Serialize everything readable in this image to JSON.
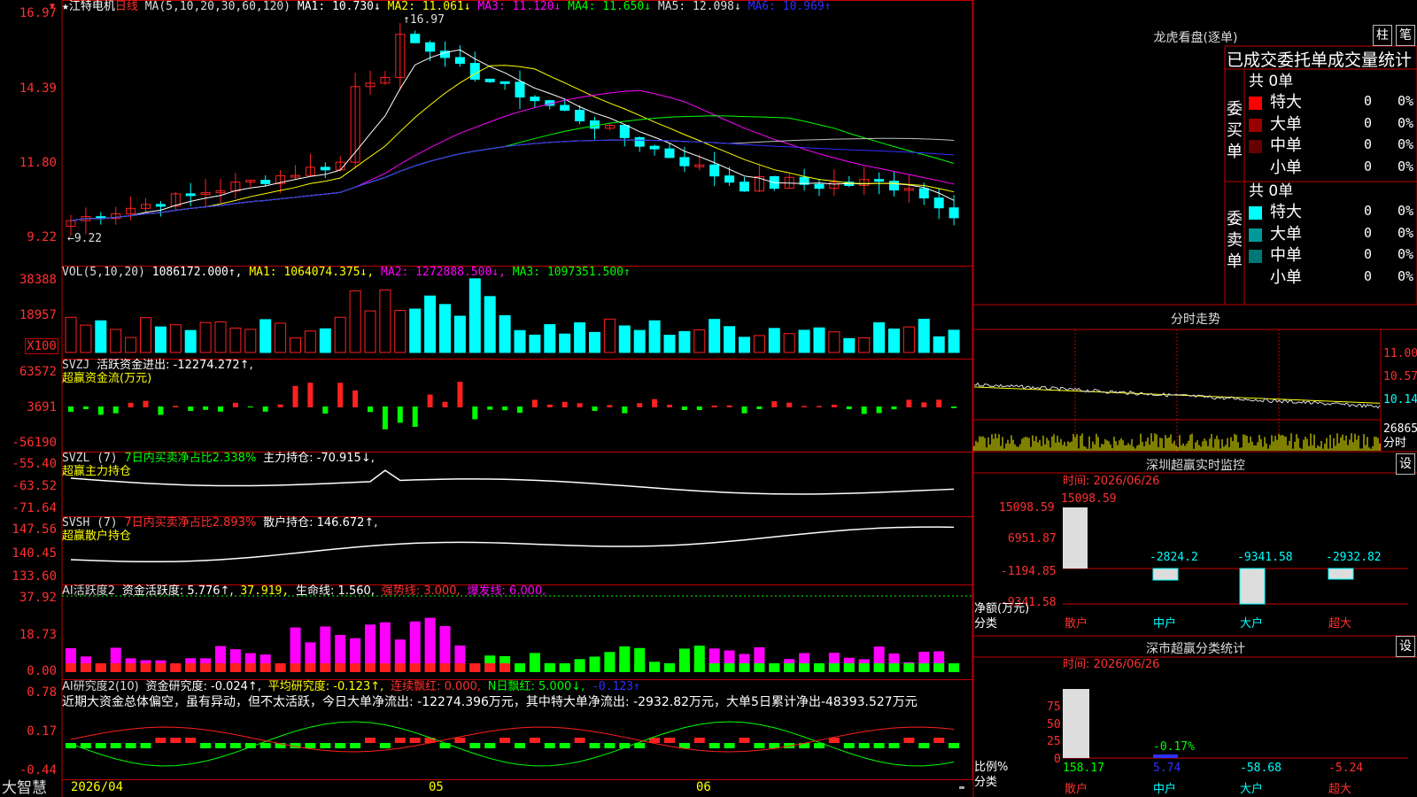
{
  "stock": {
    "star": "★",
    "name": "江特电机",
    "period": "日线",
    "period_marker": "▼"
  },
  "ma_line": {
    "label": "MA(5,10,20,30,60,120)",
    "ma1": "MA1: 10.730↓",
    "ma2": "MA2: 11.061↓",
    "ma3": "MA3: 11.120↓",
    "ma4": "MA4: 11.650↓",
    "ma5": "MA5: 12.098↓",
    "ma6": "MA6: 10.969↑"
  },
  "price_axis": [
    "16.97",
    "14.39",
    "11.80",
    "9.22"
  ],
  "price_notes": {
    "high": "16.97",
    "low": "9.22"
  },
  "vol": {
    "label": "VOL(5,10,20)",
    "value": "1086172.000↑,",
    "ma1": "MA1: 1064074.375↓,",
    "ma2": "MA2: 1272888.500↓,",
    "ma3": "MA3: 1097351.500↑",
    "axis": [
      "38388",
      "18957"
    ],
    "unit": "X100"
  },
  "svzj": {
    "label": "SVZJ",
    "text": "活跃资金进出: -12274.272↑,",
    "sub": "超赢资金流(万元)",
    "axis": [
      "63572",
      "3691",
      "-56190"
    ]
  },
  "svzl": {
    "label": "SVZL (7)",
    "pct": "7日内买卖净占比2.338%",
    "hold": "主力持仓: -70.915↓,",
    "sub": "超赢主力持仓",
    "axis": [
      "-55.40",
      "-63.52",
      "-71.64"
    ]
  },
  "svsh": {
    "label": "SVSH (7)",
    "pct": "7日内买卖净占比2.893%",
    "hold": "散户持仓: 146.672↑,",
    "sub": "超赢散户持仓",
    "axis": [
      "147.56",
      "140.45",
      "133.60"
    ]
  },
  "ai1": {
    "label": "AI活跃度2",
    "act": "资金活跃度: 5.776↑,",
    "v2": "37.919,",
    "life": "生命线: 1.560,",
    "strong": "强势线: 3.000,",
    "burst": "爆发线: 6.000,",
    "axis": [
      "37.92",
      "18.73",
      "0.00"
    ]
  },
  "ai2": {
    "label": "AI研究度2(10)",
    "res": "资金研究度: -0.024↑,",
    "avg": "平均研究度: -0.123↑,",
    "red": "连续飘红: 0.000,",
    "nred": "N日飘红: 5.000↓,",
    "last": "-0.123↑",
    "axis": [
      "0.78",
      "0.17",
      "-0.44"
    ],
    "comment": "近期大资金总体偏空，虽有异动，但不太活跃，今日大单净流出: -12274.396万元，其中特大单净流出: -2932.82万元，大单5日累计净出-48393.527万元"
  },
  "bottom": {
    "brand": "大智慧",
    "date1": "2026/04",
    "m05": "05",
    "m06": "06"
  },
  "lhb": {
    "title": "龙虎看盘(逐单)",
    "btn1": "柱",
    "btn2": "笔",
    "header": "已成交委托单成交量统计",
    "buy": {
      "side": "委买单",
      "total": "共 0单",
      "rows": [
        {
          "n": "特大",
          "v": "0",
          "p": "0%",
          "c": "#ff0000"
        },
        {
          "n": "大单",
          "v": "0",
          "p": "0%",
          "c": "#990000"
        },
        {
          "n": "中单",
          "v": "0",
          "p": "0%",
          "c": "#660000"
        },
        {
          "n": "小单",
          "v": "0",
          "p": "0%",
          "c": "#000000"
        }
      ]
    },
    "sell": {
      "side": "委卖单",
      "total": "共 0单",
      "rows": [
        {
          "n": "特大",
          "v": "0",
          "p": "0%",
          "c": "#00ffff"
        },
        {
          "n": "大单",
          "v": "0",
          "p": "0%",
          "c": "#009999"
        },
        {
          "n": "中单",
          "v": "0",
          "p": "0%",
          "c": "#007777"
        },
        {
          "n": "小单",
          "v": "0",
          "p": "0%",
          "c": "#000000"
        }
      ]
    }
  },
  "fenshi": {
    "title": "分时走势",
    "axis": [
      "11.00",
      "10.57",
      "10.14"
    ],
    "vol": "26865",
    "unit": "分时"
  },
  "sz_monitor": {
    "title": "深圳超赢实时监控",
    "btn": "设",
    "time": "时间: 2026/06/26",
    "top": "15098.59",
    "axis": [
      "15098.59",
      "6951.87",
      "-1194.85",
      "-9341.58"
    ],
    "vals": [
      "-2824.2",
      "-9341.58",
      "-2932.82"
    ],
    "ylabel": "净额(万元)",
    "xlabel": "分类",
    "cats": [
      "散户",
      "中户",
      "大户",
      "超大"
    ]
  },
  "sz_stat": {
    "title": "深市超赢分类统计",
    "btn": "设",
    "time": "时间: 2026/06/26",
    "axis": [
      "75",
      "50",
      "25",
      "0"
    ],
    "mid": "-0.17%",
    "vals": [
      "158.17",
      "5.74",
      "-58.68",
      "-5.24"
    ],
    "ylabel": "比例%",
    "xlabel": "分类",
    "cats": [
      "散户",
      "中户",
      "大户",
      "超大"
    ]
  },
  "colors": {
    "up": "#ff2020",
    "down": "#00ffff",
    "grid": "#c00000",
    "ma1": "#ffffff",
    "ma2": "#ffff00",
    "ma3": "#ff00ff",
    "ma4": "#00ff00",
    "ma5": "#c0c0c0",
    "ma6": "#3030ff"
  }
}
